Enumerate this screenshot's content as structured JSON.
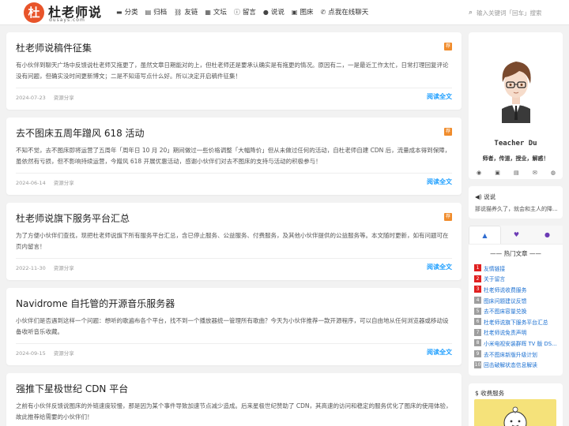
{
  "header": {
    "logo_char": "杜",
    "logo_text": "杜老师说",
    "logo_sub": "dusays.com",
    "nav": [
      {
        "icon": "folder-icon",
        "glyph": "▬",
        "label": "分类"
      },
      {
        "icon": "archive-icon",
        "glyph": "▤",
        "label": "归档"
      },
      {
        "icon": "link-icon",
        "glyph": "⛓",
        "label": "友链"
      },
      {
        "icon": "altar-icon",
        "glyph": "▦",
        "label": "文坛"
      },
      {
        "icon": "info-icon",
        "glyph": "ⓘ",
        "label": "留言"
      },
      {
        "icon": "comment-icon",
        "glyph": "●",
        "label": "说说"
      },
      {
        "icon": "image-icon",
        "glyph": "▣",
        "label": "图床"
      },
      {
        "icon": "phone-icon",
        "glyph": "✆",
        "label": "点我在线聊天"
      }
    ],
    "search_placeholder": "输入关键词「回车」搜索"
  },
  "posts": [
    {
      "title": "杜老师说稿件征集",
      "tag": "荐",
      "excerpt": "有小伙伴到聊天广场中反馈说杜老师又拖更了，虽然文章日期能对的上，但杜老师还是要承认确实是有拖更的情况。原因有二，一是最近工作太忙，日常打理回复评论没有问题，但确实没时间更新博文；二是不知道写点什么好。所以决定开启稿件征集！",
      "date": "2024-07-23",
      "category": "资源分享",
      "more": "阅读全文"
    },
    {
      "title": "去不图床五周年蹭风 618 活动",
      "tag": "荐",
      "excerpt": "不知不觉，去不图床即将运营了五周年「周年日 10 月 20」期间做过一些价格调整「大幅降价」但从未做过任何的活动，自杜老师自建 CDN 后，流量成本得到保障，虽依然有亏损，但不影响持续运营，今蹭风 618 开展优惠活动，感谢小伙伴们对去不图床的支持与活动的积极参与！",
      "date": "2024-06-14",
      "category": "资源分享",
      "more": "阅读全文"
    },
    {
      "title": "杜老师说旗下服务平台汇总",
      "tag": "荐",
      "excerpt": "为了方便小伙伴们查找，现把杜老师说旗下所有服务平台汇总，含已停止服务、公益服务、付费服务，及其他小伙伴提供的公益服务等。本文随时更新，如有问题可在页内留言！",
      "date": "2022-11-30",
      "category": "资源分享",
      "more": "阅读全文"
    },
    {
      "title": "Navidrome 自托管的开源音乐服务器",
      "tag": "",
      "excerpt": "小伙伴们是否遇到这样一个问题：想听的歌遍布各个平台，找不到一个播放器统一管理所有歌曲？今天为小伙伴推荐一款开源程序，可以自由地从任何浏览器或移动设备收听音乐收藏。",
      "date": "2024-09-15",
      "category": "资源分享",
      "more": "阅读全文"
    },
    {
      "title": "强推下星极世纪 CDN 平台",
      "tag": "",
      "excerpt": "之前有小伙伴反馈说图床的外链速度较慢，那是因为某个事件导致加速节点减少造成。后来星极世纪赞助了 CDN，其高速的访问和稳定的服务优化了图床的使用体验，故此推荐给需要的小伙伴们！",
      "date": "",
      "category": "",
      "more": ""
    }
  ],
  "profile": {
    "name": "Teacher Du",
    "motto": "师者，传道，授业，解惑！",
    "icons": [
      "rss-icon",
      "image-icon",
      "chat-icon",
      "mail-icon",
      "github-icon"
    ]
  },
  "announcement": {
    "heading": "说说",
    "text": "那说猫养久了，就会和主人的降..."
  },
  "tabs": [
    {
      "name": "thumbs-up-icon",
      "glyph": "👍"
    },
    {
      "name": "heart-icon",
      "glyph": "♥"
    },
    {
      "name": "comment-icon",
      "glyph": "●"
    }
  ],
  "hot": {
    "title": "—— 热门文章 ——",
    "items": [
      "友情链接",
      "关于留言",
      "杜老师说收费服务",
      "图床问题建议反馈",
      "去不图床容量兑换",
      "杜老师说旗下服务平台汇总",
      "杜老师说免责声明",
      "小米电视安装群晖 TV 版 DS...",
      "去不图床新版升级计划",
      "回击破解状态信息解读"
    ]
  },
  "fee": {
    "heading": "收费服务"
  },
  "colors": {
    "accent": "#1e9fff",
    "logo": "#e8542a",
    "tag": "#f08c2c",
    "rank_red": "#e02020"
  }
}
